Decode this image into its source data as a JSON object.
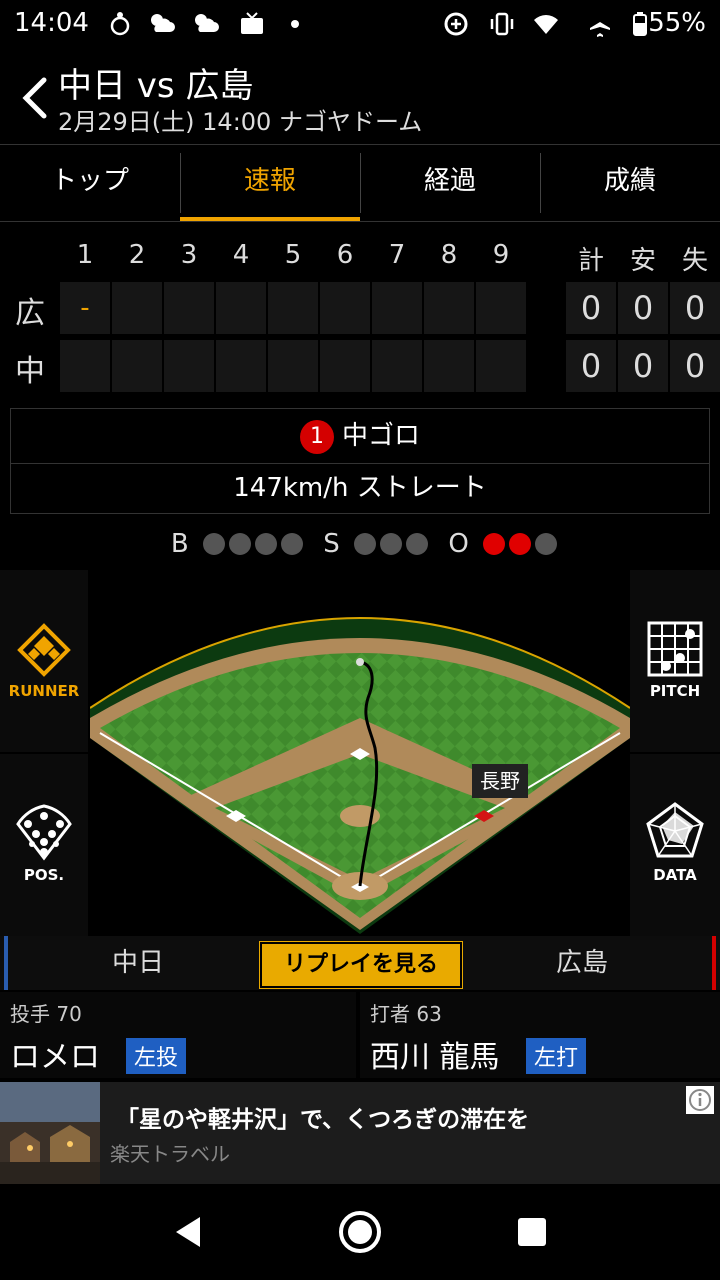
{
  "status_bar": {
    "time": "14:04",
    "battery": "55%"
  },
  "header": {
    "title": "中日 vs 広島",
    "subtitle": "2月29日(土) 14:00 ナゴヤドーム"
  },
  "tabs": [
    {
      "label": "トップ",
      "active": false
    },
    {
      "label": "速報",
      "active": true
    },
    {
      "label": "経過",
      "active": false
    },
    {
      "label": "成績",
      "active": false
    }
  ],
  "scoreboard": {
    "innings": [
      "1",
      "2",
      "3",
      "4",
      "5",
      "6",
      "7",
      "8",
      "9"
    ],
    "totals_headers": [
      "計",
      "安",
      "失"
    ],
    "rows": [
      {
        "team": "広",
        "innings": [
          "-",
          "",
          "",
          "",
          "",
          "",
          "",
          "",
          ""
        ],
        "totals": [
          "0",
          "0",
          "0"
        ]
      },
      {
        "team": "中",
        "innings": [
          "",
          "",
          "",
          "",
          "",
          "",
          "",
          "",
          ""
        ],
        "totals": [
          "0",
          "0",
          "0"
        ]
      }
    ]
  },
  "play": {
    "number": "1",
    "result": "中ゴロ",
    "pitch": "147km/h ストレート"
  },
  "count": {
    "b_label": "B",
    "s_label": "S",
    "o_label": "O",
    "balls": 0,
    "strikes": 0,
    "outs": 2
  },
  "side_buttons": {
    "runner": "RUNNER",
    "pos": "POS.",
    "pitch": "PITCH",
    "data": "DATA"
  },
  "field": {
    "fielder_label": "長野"
  },
  "teams": {
    "left": "中日",
    "right": "広島",
    "replay": "リプレイを見る"
  },
  "pitcher": {
    "role": "投手 70",
    "name": "ロメロ",
    "hand": "左投"
  },
  "batter": {
    "role": "打者 63",
    "name": "西川 龍馬",
    "hand": "左打"
  },
  "ad": {
    "title": "「星のや軽井沢」で、くつろぎの滞在を",
    "source": "楽天トラベル"
  },
  "colors": {
    "accent": "#f0a400",
    "out_dot": "#e00000",
    "hand_badge": "#1f5fc2",
    "home_team": "#2a5db0",
    "away_team": "#d40000"
  }
}
